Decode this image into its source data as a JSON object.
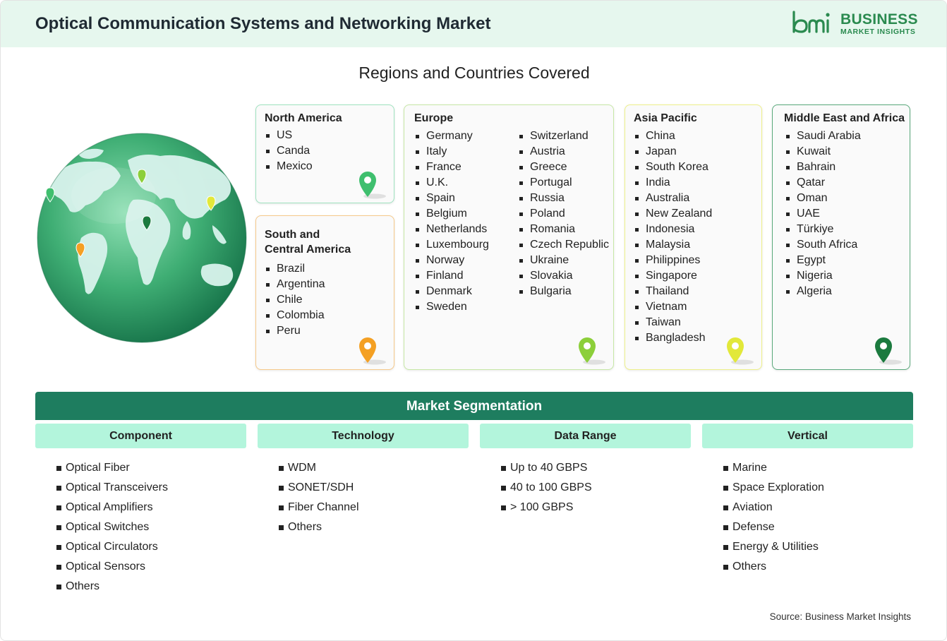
{
  "header": {
    "title": "Optical Communication Systems and Networking Market",
    "logo_line1": "BUSINESS",
    "logo_line2": "MARKET INSIGHTS",
    "logo_mark": "bmi"
  },
  "subtitle": "Regions and Countries Covered",
  "regions": {
    "north_america": {
      "title": "North America",
      "items": [
        "US",
        "Canda",
        "Mexico"
      ],
      "pin_color": "#3fbf6e"
    },
    "south_central_america": {
      "title_line1": "South and",
      "title_line2": "Central America",
      "items": [
        "Brazil",
        "Argentina",
        "Chile",
        "Colombia",
        "Peru"
      ],
      "pin_color": "#f4a023"
    },
    "europe": {
      "title": "Europe",
      "col1": [
        "Germany",
        "Italy",
        "France",
        "U.K.",
        "Spain",
        "Belgium",
        "Netherlands",
        "Luxembourg",
        "Norway",
        "Finland",
        "Denmark",
        "Sweden"
      ],
      "col2": [
        "Switzerland",
        "Austria",
        "Greece",
        "Portugal",
        "Russia",
        "Poland",
        "Romania",
        "Czech Republic",
        "Ukraine",
        "Slovakia",
        "Bulgaria"
      ],
      "pin_color": "#8ccf3a"
    },
    "asia_pacific": {
      "title": "Asia Pacific",
      "items": [
        "China",
        "Japan",
        "South Korea",
        "India",
        "Australia",
        "New Zealand",
        "Indonesia",
        "Malaysia",
        "Philippines",
        "Singapore",
        "Thailand",
        "Vietnam",
        "Taiwan",
        "Bangladesh"
      ],
      "pin_color": "#e2e83a"
    },
    "mea": {
      "title": "Middle East and Africa",
      "items": [
        "Saudi Arabia",
        "Kuwait",
        "Bahrain",
        "Qatar",
        "Oman",
        "UAE",
        "Türkiye",
        "South Africa",
        "Egypt",
        "Nigeria",
        "Algeria"
      ],
      "pin_color": "#1b7a3e"
    }
  },
  "segmentation": {
    "title": "Market Segmentation",
    "columns": [
      {
        "head": "Component",
        "items": [
          "Optical Fiber",
          "Optical Transceivers",
          "Optical Amplifiers",
          "Optical Switches",
          "Optical Circulators",
          "Optical Sensors",
          "Others"
        ]
      },
      {
        "head": "Technology",
        "items": [
          "WDM",
          "SONET/SDH",
          "Fiber Channel",
          "Others"
        ]
      },
      {
        "head": "Data Range",
        "items": [
          "Up to 40 GBPS",
          "40 to 100 GBPS",
          "> 100 GBPS"
        ]
      },
      {
        "head": "Vertical",
        "items": [
          "Marine",
          "Space Exploration",
          "Aviation",
          "Defense",
          "Energy & Utilities",
          "Others"
        ]
      }
    ]
  },
  "source": "Source: Business Market Insights",
  "colors": {
    "brand_green": "#2a8a4f",
    "header_bg": "#e6f7ee",
    "seg_bar": "#1e7d5f",
    "seg_head": "#b3f5dc"
  },
  "icons": {
    "globe": "globe-illustration",
    "pin": "map-pin-icon"
  }
}
